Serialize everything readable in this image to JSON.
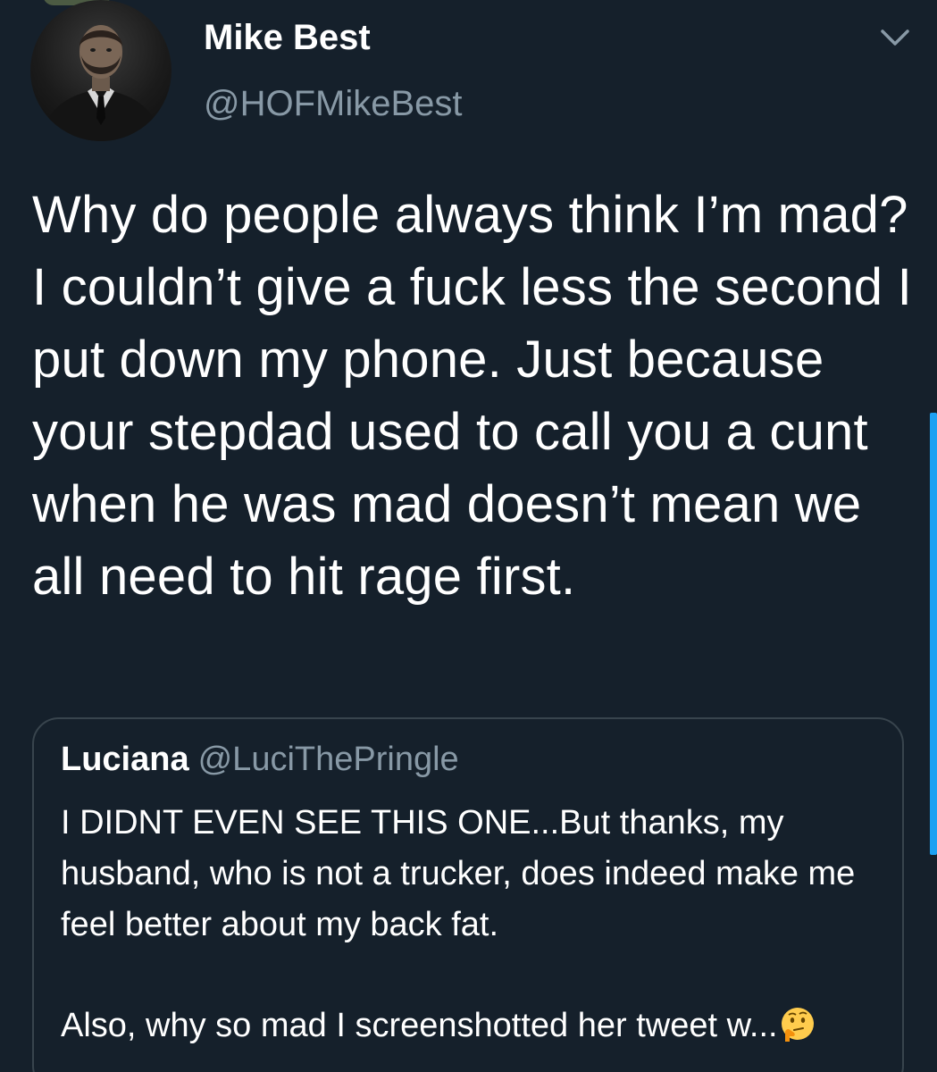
{
  "tweet": {
    "author": {
      "name": "Mike Best",
      "handle": "@HOFMikeBest"
    },
    "text": "Why do people always think I’m mad? I couldn’t give a fuck less the second I put down my phone. Just because your stepdad used to call you a cunt when he was mad doesn’t mean we all need to hit rage first.",
    "menu_icon": "chevron-down-icon"
  },
  "quote": {
    "name": "Luciana",
    "handle": "@LuciThePringle",
    "body": "I DIDNT EVEN SEE THIS ONE...But thanks, my husband, who is not a trucker, does indeed make me feel better about my back fat.",
    "last_line": "Also, why so mad I screenshotted her tweet w...",
    "trailing_icon": "thinking-face-icon"
  },
  "colors": {
    "background": "#15202b",
    "primary_text": "#ffffff",
    "secondary_text": "#8899a6",
    "border": "#38444d",
    "accent": "#1da1f2"
  }
}
